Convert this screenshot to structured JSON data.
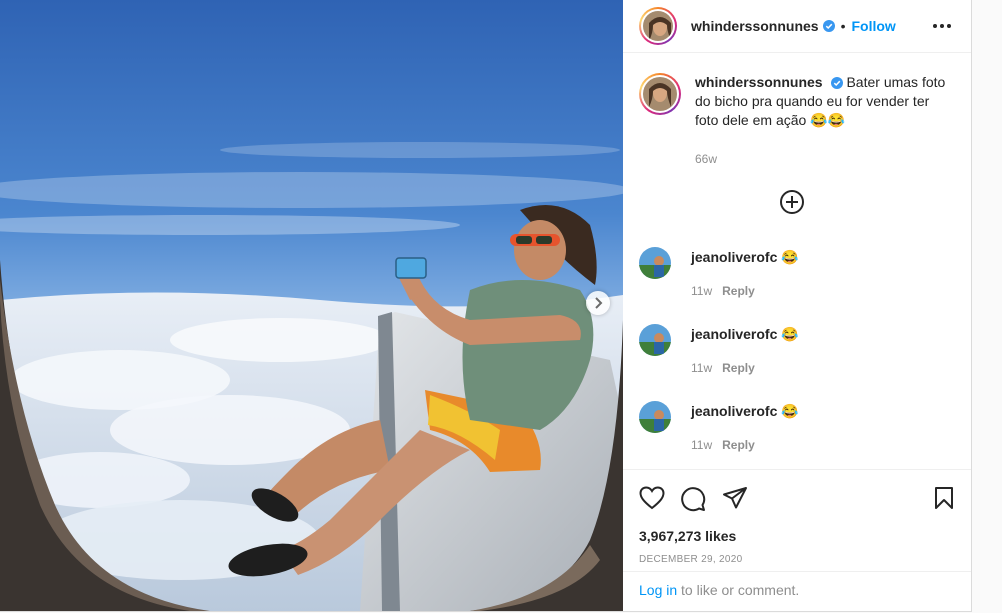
{
  "post": {
    "author": "whinderssonnunes",
    "follow_label": "Follow",
    "caption": "Bater umas foto do bicho pra quando eu for vender ter foto dele em ação 😂😂",
    "caption_age": "66w",
    "likes": "3,967,273 likes",
    "date": "DECEMBER 29, 2020"
  },
  "comments": [
    {
      "user": "jeanoliverofc",
      "text": "😂",
      "age": "11w",
      "reply_label": "Reply"
    },
    {
      "user": "jeanoliverofc",
      "text": "😂",
      "age": "11w",
      "reply_label": "Reply"
    },
    {
      "user": "jeanoliverofc",
      "text": "😂",
      "age": "11w",
      "reply_label": "Reply"
    }
  ],
  "footer": {
    "login_label": "Log in",
    "login_suffix": " to like or comment."
  },
  "colors": {
    "link_blue": "#0095f6",
    "verified_blue": "#3897f0",
    "muted_text": "#8e8e8e"
  },
  "icons": [
    "more-icon",
    "verified-icon",
    "add-comments-icon",
    "heart-icon",
    "comment-icon",
    "share-icon",
    "bookmark-icon",
    "next-arrow-icon"
  ]
}
